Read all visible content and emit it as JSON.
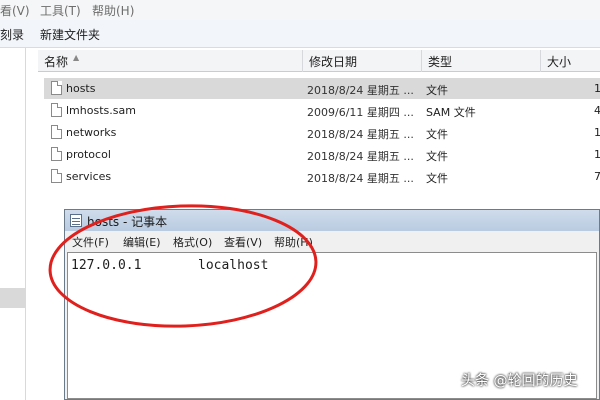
{
  "explorer": {
    "menu": [
      "看(V)",
      "工具(T)",
      "帮助(H)"
    ],
    "toolbar": [
      "刻录",
      "新建文件夹"
    ],
    "columns": {
      "name": "名称",
      "date": "修改日期",
      "type": "类型",
      "size": "大小"
    },
    "files": [
      {
        "name": "hosts",
        "date": "2018/8/24 星期五 ...",
        "type": "文件",
        "size": "1",
        "selected": true
      },
      {
        "name": "lmhosts.sam",
        "date": "2009/6/11 星期四 ...",
        "type": "SAM 文件",
        "size": "4",
        "selected": false
      },
      {
        "name": "networks",
        "date": "2018/8/24 星期五 ...",
        "type": "文件",
        "size": "1",
        "selected": false
      },
      {
        "name": "protocol",
        "date": "2018/8/24 星期五 ...",
        "type": "文件",
        "size": "1",
        "selected": false
      },
      {
        "name": "services",
        "date": "2018/8/24 星期五 ...",
        "type": "文件",
        "size": "7",
        "selected": false
      }
    ]
  },
  "notepad": {
    "title": "hosts - 记事本",
    "menu": [
      "文件(F)",
      "编辑(E)",
      "格式(O)",
      "查看(V)",
      "帮助(H)"
    ],
    "content": {
      "ip": "127.0.0.1",
      "host": "localhost"
    }
  },
  "annotation": {
    "color": "#e0201c",
    "shape": "ellipse"
  },
  "watermark": "头条 @轮回的历史"
}
